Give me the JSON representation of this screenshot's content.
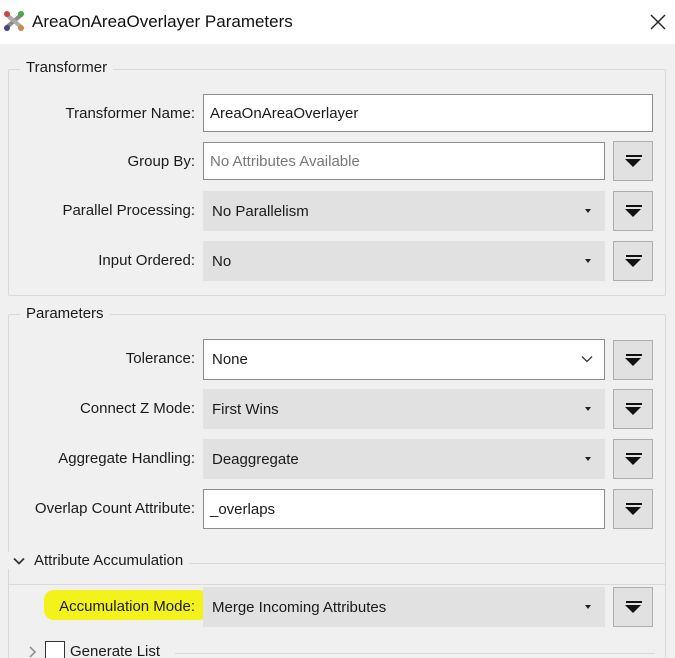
{
  "window": {
    "title": "AreaOnAreaOverlayer Parameters",
    "app_icon": "fme-transformer-icon",
    "close_icon": "close-icon"
  },
  "transformer_group": {
    "legend": "Transformer",
    "transformer_name": {
      "label": "Transformer Name:",
      "value": "AreaOnAreaOverlayer"
    },
    "group_by": {
      "label": "Group By:",
      "placeholder": "No Attributes Available"
    },
    "parallel_processing": {
      "label": "Parallel Processing:",
      "value": "No Parallelism"
    },
    "input_ordered": {
      "label": "Input Ordered:",
      "value": "No"
    }
  },
  "parameters_group": {
    "legend": "Parameters",
    "tolerance": {
      "label": "Tolerance:",
      "value": "None"
    },
    "connect_z_mode": {
      "label": "Connect Z Mode:",
      "value": "First Wins"
    },
    "aggregate_handling": {
      "label": "Aggregate Handling:",
      "value": "Deaggregate"
    },
    "overlap_count_attribute": {
      "label": "Overlap Count Attribute:",
      "value": "_overlaps"
    }
  },
  "attribute_accumulation_group": {
    "legend": "Attribute Accumulation",
    "expanded": true,
    "accumulation_mode": {
      "label": "Accumulation Mode:",
      "value": "Merge Incoming Attributes",
      "highlight_color": "#f3f31b"
    },
    "generate_list": {
      "label": "Generate List",
      "checked": false,
      "expanded": false
    }
  },
  "colors": {
    "panel_background": "#f0f0f0",
    "dropdown_background": "#e1e1e1",
    "highlight": "#f3f31b"
  }
}
